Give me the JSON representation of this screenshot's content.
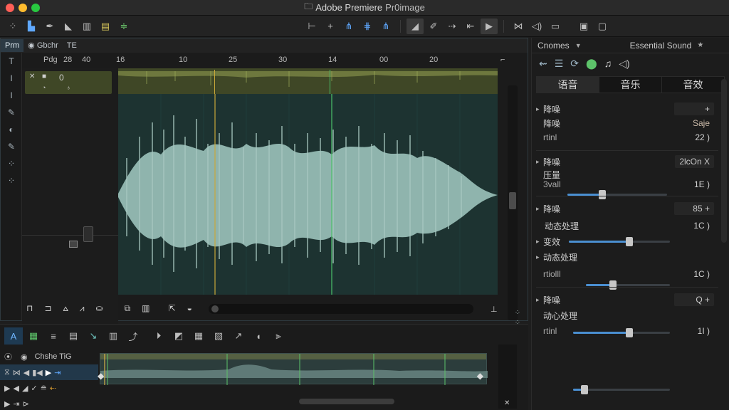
{
  "window": {
    "title_main": "Adobe Premiere ",
    "title_suffix": "Pr0image"
  },
  "traffic_lights": {
    "close": "#ff5f57",
    "minimize": "#febc2e",
    "zoom": "#28c840"
  },
  "toolbar": {
    "left_icons": [
      "grid-icon",
      "select-icon",
      "pen-icon",
      "hand-icon",
      "bars-icon",
      "level-icon",
      "eq-icon"
    ],
    "center_icons": [
      "trim-icon",
      "plus-icon",
      "wave-icon",
      "wave-icon",
      "wave-icon",
      "brush-icon",
      "cursor-icon",
      "arrow-icon",
      "cut-icon",
      "play-icon",
      "sep",
      "x-icon",
      "speaker-icon",
      "film-icon",
      "monitor-icon",
      "square-icon"
    ]
  },
  "source_panel": {
    "tabs": [
      "Prm",
      "Gbchr",
      "TE"
    ],
    "ruler_labels": [
      "Pdg",
      "28",
      "40",
      "16",
      "10",
      "25",
      "30",
      "14",
      "00",
      "20"
    ],
    "track_value": "0",
    "left_tools": [
      "T",
      "I",
      "I",
      "✎",
      "◐",
      "✎",
      "⁘",
      "⁘"
    ]
  },
  "timeline": {
    "tools": [
      "A",
      "▦",
      "≡",
      "▤",
      "↘",
      "▥",
      "⤴",
      "⏵",
      "◩",
      "▦",
      "▧",
      "↗",
      "◖",
      "⫸"
    ],
    "track_label": "Chshe TiG"
  },
  "essential_sound": {
    "tab_left": "Cnomes",
    "tab_right": "Essential Sound",
    "types": [
      "语音",
      "音乐",
      "音效"
    ],
    "rows": [
      {
        "label": "降噪",
        "badge": "+"
      },
      {
        "label": "降噪",
        "right_text": "Saje"
      },
      {
        "label": "rtinl",
        "value": "22 )"
      },
      {
        "label": "降噪",
        "badge": "2lcOn X"
      },
      {
        "label": "压量",
        "sub": "3vall",
        "value": "1E )"
      },
      {
        "label": "降噪",
        "badge": "85 +"
      },
      {
        "label": "动态处理",
        "value": "1C )"
      },
      {
        "label": "变效"
      },
      {
        "label": "动态处理"
      },
      {
        "label": "rtiolll",
        "value": "1C )"
      },
      {
        "label": "降噪",
        "badge": "Q +"
      },
      {
        "label": "动心处理"
      },
      {
        "label": "rtinl",
        "value": "1I )"
      }
    ],
    "sliders": [
      0.35,
      0.6,
      0.32,
      0.58,
      0.12
    ]
  }
}
